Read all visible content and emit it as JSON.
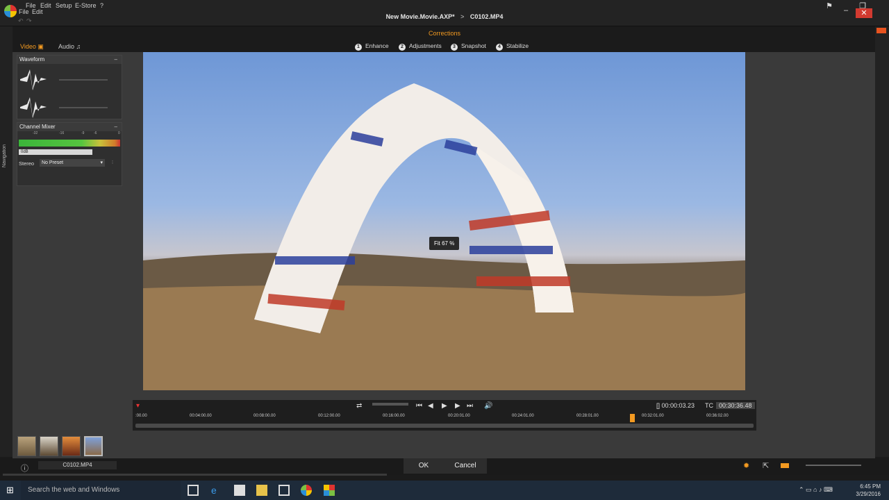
{
  "menu": [
    "File",
    "Edit",
    "Setup",
    "E-Store"
  ],
  "submenu": [
    "File",
    "Edit"
  ],
  "title": {
    "project": "New Movie.Movie.AXP*",
    "separator": ">",
    "clip": "C0102.MP4"
  },
  "corrections_label": "Corrections",
  "tabs": {
    "video": "Video",
    "audio": "Audio"
  },
  "steps": [
    {
      "num": "1",
      "label": "Enhance"
    },
    {
      "num": "2",
      "label": "Adjustments"
    },
    {
      "num": "3",
      "label": "Snapshot"
    },
    {
      "num": "4",
      "label": "Stabilize"
    }
  ],
  "waveform": {
    "title": "Waveform",
    "min": "–"
  },
  "channel_mixer": {
    "title": "Channel Mixer",
    "scale": [
      "-32",
      "-16",
      "-9",
      "-6",
      "0"
    ],
    "db_value": "0dB",
    "stereo_label": "Stereo",
    "preset": "No Preset"
  },
  "side_label": "Navigation",
  "preview": {
    "fit": "Fit 67 %"
  },
  "transport": {
    "duration": "[] 00:00:03.23",
    "tc_label": "TC",
    "timecode": "00:30:36.48",
    "ticks": [
      ":00.00",
      "00:04:00.00",
      "00:08:00.00",
      "00:12:00.00",
      "00:16:00.00",
      "00:20:01.00",
      "00:24:01.00",
      "00:28:01.00",
      "00:32:01.00",
      "00:36:02.00"
    ]
  },
  "clip_name": "C0102.MP4",
  "buttons": {
    "ok": "OK",
    "cancel": "Cancel"
  },
  "taskbar": {
    "search": "Search the web and Windows",
    "time": "6:45 PM",
    "date": "3/29/2016"
  },
  "colors": {
    "accent": "#f39a21",
    "close": "#d23a30"
  }
}
